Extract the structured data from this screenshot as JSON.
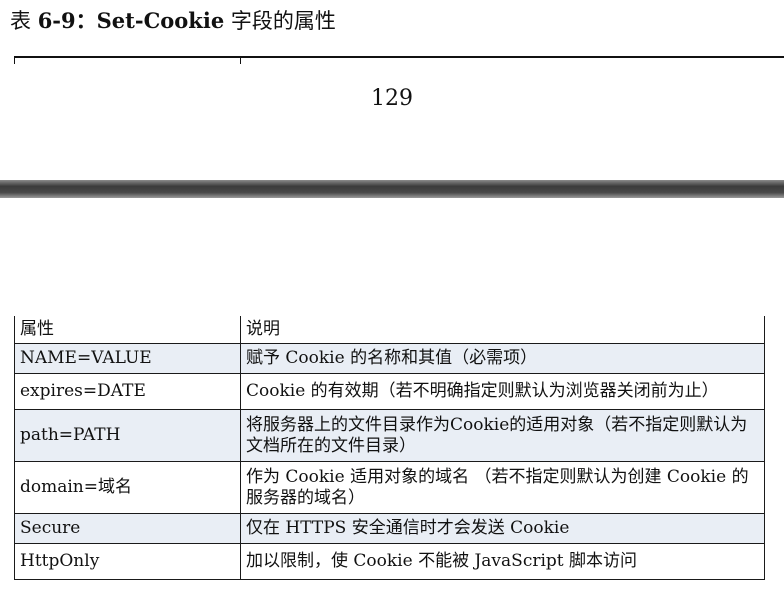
{
  "caption": {
    "prefix": "表 ",
    "number": "6-9",
    "colon": "：",
    "name": "Set-Cookie",
    "suffix": " 字段的属性"
  },
  "page_number": "129",
  "table": {
    "headers": [
      "属性",
      "说明"
    ],
    "rows": [
      {
        "attribute": "NAME=VALUE",
        "description": "赋予 Cookie 的名称和其值（必需项）",
        "shaded": true
      },
      {
        "attribute": "expires=DATE",
        "description": "Cookie 的有效期（若不明确指定则默认为浏览器关闭前为止）",
        "shaded": false
      },
      {
        "attribute": "path=PATH",
        "description": "将服务器上的文件目录作为Cookie的适用对象（若不指定则默认为文档所在的文件目录）",
        "shaded": true
      },
      {
        "attribute": "domain=域名",
        "description": "作为 Cookie 适用对象的域名 （若不指定则默认为创建 Cookie 的服务器的域名）",
        "shaded": false
      },
      {
        "attribute": "Secure",
        "description": "仅在 HTTPS 安全通信时才会发送 Cookie",
        "shaded": true
      },
      {
        "attribute": "HttpOnly",
        "description": "加以限制，使 Cookie 不能被 JavaScript 脚本访问",
        "shaded": false
      }
    ]
  },
  "colors": {
    "row_shade": "#e9eef5",
    "divider": "#3b3b3b",
    "text": "#111111"
  }
}
